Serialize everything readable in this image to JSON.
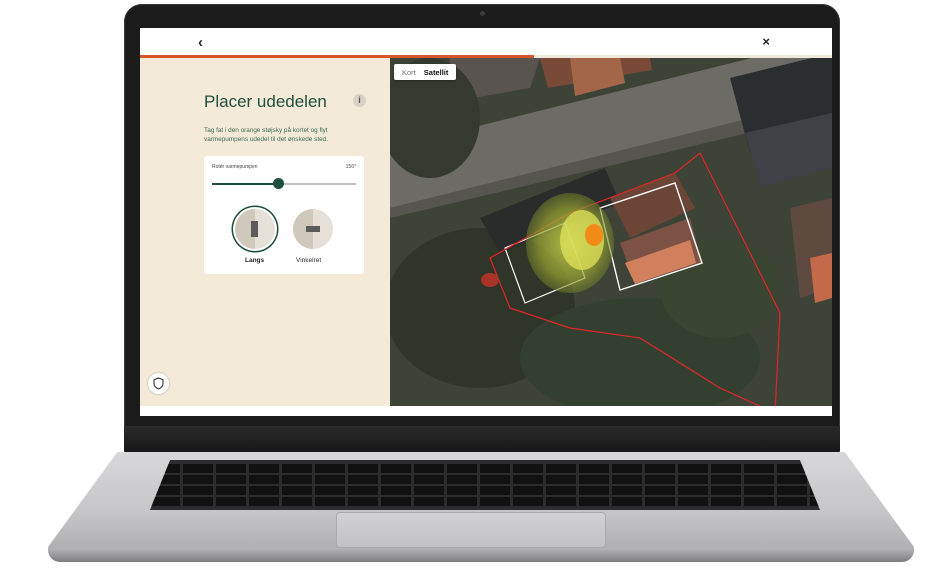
{
  "topbar": {
    "back_icon": "‹",
    "close_icon": "×"
  },
  "progress": {
    "value": 0.57,
    "color": "#d8572a"
  },
  "panel": {
    "title": "Placer udedelen",
    "info_icon": "i",
    "description": "Tag fat i den orange støjsky på kortet og flyt varmepumpens udedel til det ønskede sted.",
    "slider": {
      "label": "Rotér varmepumpen",
      "value_text": "156°",
      "fraction": 0.46
    },
    "options": [
      {
        "label": "Langs",
        "selected": true,
        "icon": "unit-vertical-icon"
      },
      {
        "label": "Vinkelret",
        "selected": false,
        "icon": "unit-horizontal-icon"
      }
    ]
  },
  "map": {
    "toggle": {
      "kort": "Kort",
      "satellit": "Satellit",
      "active": "Satellit"
    }
  },
  "colors": {
    "accent": "#d8572a",
    "brand_green": "#1f4f3c",
    "panel_bg": "#f3ebd8",
    "noise_orange": "#f28a18"
  }
}
